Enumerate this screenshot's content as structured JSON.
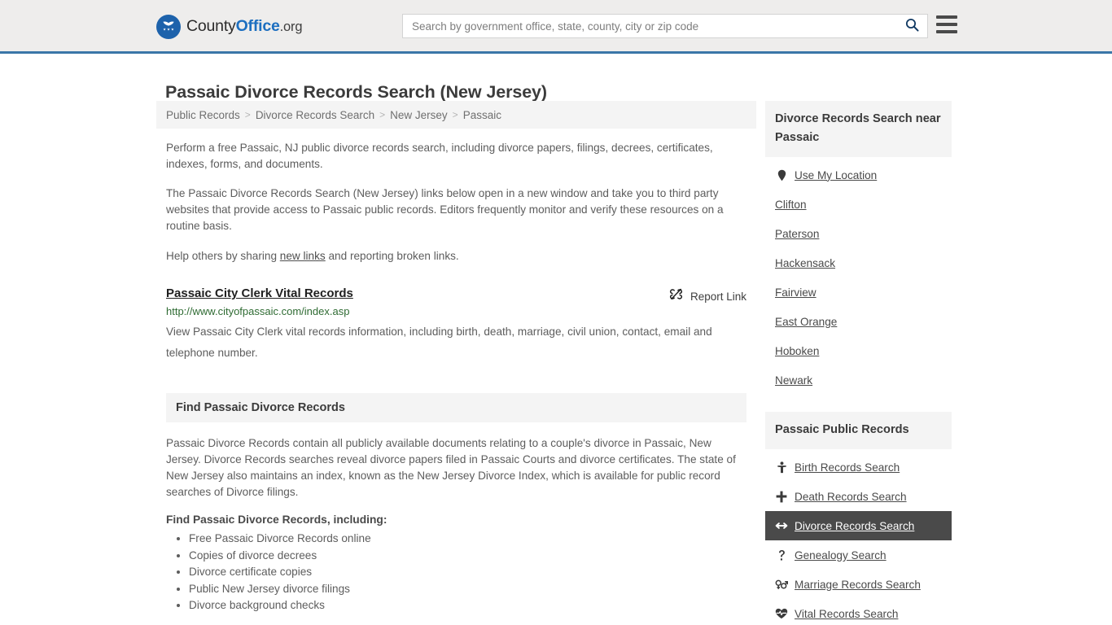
{
  "header": {
    "brand": {
      "part1": "County",
      "part2": "Office",
      "part3": ".org",
      "icon": "eagle-seal-logo"
    },
    "search": {
      "placeholder": "Search by government office, state, county, city or zip code",
      "value": "",
      "icon": "search-icon"
    },
    "menu_icon": "hamburger-menu-icon",
    "accent_color": "#3a76a8",
    "background_color": "#eeedec"
  },
  "page": {
    "title": "Passaic Divorce Records Search (New Jersey)",
    "breadcrumb": [
      {
        "label": "Public Records",
        "link": true
      },
      {
        "label": "Divorce Records Search",
        "link": true
      },
      {
        "label": "New Jersey",
        "link": true
      },
      {
        "label": "Passaic",
        "link": false
      }
    ],
    "separator": ">",
    "intro_paragraph": "Perform a free Passaic, NJ public divorce records search, including divorce papers, filings, decrees, certificates, indexes, forms, and documents.",
    "second_paragraph": "The Passaic Divorce Records Search (New Jersey) links below open in a new window and take you to third party websites that provide access to Passaic public records. Editors frequently monitor and verify these resources on a routine basis.",
    "help_prefix": "Help others by sharing ",
    "help_link": "new links",
    "help_suffix": " and reporting broken links."
  },
  "result": {
    "title": "Passaic City Clerk Vital Records",
    "url": "http://www.cityofpassaic.com/index.asp",
    "description": "View Passaic City Clerk vital records information, including birth, death, marriage, civil union, contact, email and telephone number.",
    "report": {
      "label": "Report Link",
      "icon": "broken-link-icon"
    },
    "url_color": "#2f6b33"
  },
  "find_section": {
    "heading": "Find Passaic Divorce Records",
    "paragraph": "Passaic Divorce Records contain all publicly available documents relating to a couple's divorce in Passaic, New Jersey. Divorce Records searches reveal divorce papers filed in Passaic Courts and divorce certificates. The state of New Jersey also maintains an index, known as the New Jersey Divorce Index, which is available for public record searches of Divorce filings.",
    "subheading": "Find Passaic Divorce Records, including:",
    "bullets": [
      "Free Passaic Divorce Records online",
      "Copies of divorce decrees",
      "Divorce certificate copies",
      "Public New Jersey divorce filings",
      "Divorce background checks"
    ]
  },
  "sidebar": {
    "nearby": {
      "heading": "Divorce Records Search near Passaic",
      "items": [
        {
          "label": "Use My Location",
          "icon": "map-pin-icon"
        },
        {
          "label": "Clifton",
          "icon": ""
        },
        {
          "label": "Paterson",
          "icon": ""
        },
        {
          "label": "Hackensack",
          "icon": ""
        },
        {
          "label": "Fairview",
          "icon": ""
        },
        {
          "label": "East Orange",
          "icon": ""
        },
        {
          "label": "Hoboken",
          "icon": ""
        },
        {
          "label": "Newark",
          "icon": ""
        }
      ]
    },
    "public_records": {
      "heading": "Passaic Public Records",
      "active_index": 2,
      "active_background": "#4a4a4a",
      "items": [
        {
          "label": "Birth Records Search",
          "icon": "baby-icon"
        },
        {
          "label": "Death Records Search",
          "icon": "cross-icon"
        },
        {
          "label": "Divorce Records Search",
          "icon": "split-arrows-icon"
        },
        {
          "label": "Genealogy Search",
          "icon": "question-mark-icon"
        },
        {
          "label": "Marriage Records Search",
          "icon": "gender-symbols-icon"
        },
        {
          "label": "Vital Records Search",
          "icon": "heart-pulse-icon"
        }
      ]
    }
  }
}
